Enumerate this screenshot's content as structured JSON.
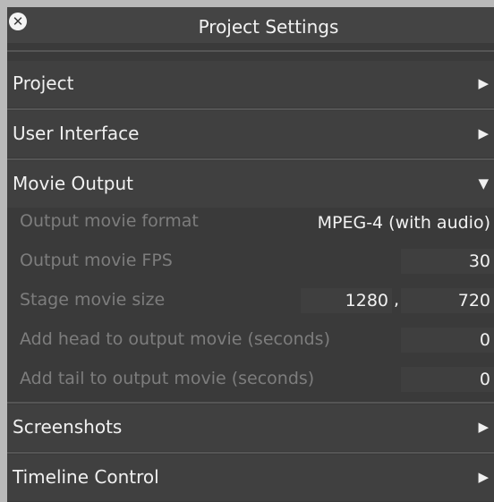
{
  "window": {
    "title": "Project Settings"
  },
  "sections": [
    {
      "label": "Project",
      "state": "collapsed"
    },
    {
      "label": "User Interface",
      "state": "collapsed"
    },
    {
      "label": "Movie Output",
      "state": "expanded"
    },
    {
      "label": "Screenshots",
      "state": "collapsed"
    },
    {
      "label": "Timeline Control",
      "state": "collapsed"
    }
  ],
  "arrows": {
    "collapsed": "▶",
    "expanded": "▼"
  },
  "movie_output": {
    "format_label": "Output movie format",
    "format_value": "MPEG-4 (with audio)",
    "fps_label": "Output movie FPS",
    "fps_value": "30",
    "size_label": "Stage movie size",
    "size_width": "1280",
    "size_separator": ",",
    "size_height": "720",
    "head_label": "Add head to output movie (seconds)",
    "head_value": "0",
    "tail_label": "Add tail to output movie (seconds)",
    "tail_value": "0"
  },
  "icons": {
    "close": "close-icon",
    "collapsed_arrow": "arrow-right-icon",
    "expanded_arrow": "arrow-down-icon"
  },
  "colors": {
    "panel_bg": "#3a3a3a",
    "header_bg": "#404040",
    "field_bg": "#3f3f3f",
    "label_muted": "#7d7d7d",
    "text": "#f0f0f0",
    "outer_bg": "#b9b9b9"
  }
}
